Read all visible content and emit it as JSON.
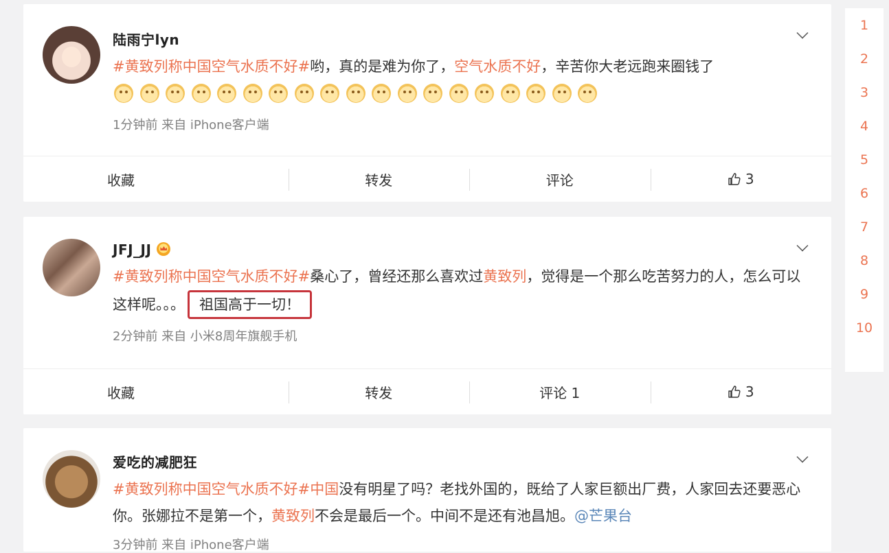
{
  "posts": [
    {
      "username": "陆雨宁lyn",
      "segments": [
        {
          "text": "#黄致列称中国空气水质不好#",
          "type": "hashtag"
        },
        {
          "text": "哟，真的是难为你了，",
          "type": "text"
        },
        {
          "text": "空气水质不好",
          "type": "highlight"
        },
        {
          "text": "，辛苦你大老远跑来圈钱了",
          "type": "text"
        }
      ],
      "emoji_name": "doge-emoji",
      "emoji_count": 19,
      "meta": "1分钟前 来自 iPhone客户端",
      "actions": {
        "favorite": "收藏",
        "repost": "转发",
        "comment": "评论",
        "like_count": "3"
      }
    },
    {
      "username": "JFJ_JJ",
      "segments": [
        {
          "text": "#黄致列称中国空气水质不好#",
          "type": "hashtag"
        },
        {
          "text": "桑心了，曾经还那么喜欢过",
          "type": "text"
        },
        {
          "text": "黄致列",
          "type": "highlight"
        },
        {
          "text": "，觉得是一个那么吃苦努力的人，怎么可以这样呢。。。",
          "type": "text"
        },
        {
          "text": "祖国高于一切！",
          "type": "boxed"
        }
      ],
      "meta": "2分钟前 来自 小米8周年旗舰手机",
      "actions": {
        "favorite": "收藏",
        "repost": "转发",
        "comment": "评论 1",
        "like_count": "3"
      }
    },
    {
      "username": "爱吃的减肥狂",
      "segments": [
        {
          "text": "#黄致列称中国空气水质不好#",
          "type": "hashtag"
        },
        {
          "text": "中国",
          "type": "highlight"
        },
        {
          "text": "没有明星了吗？老找外国的，既给了人家巨额出厂费，人家回去还要恶心你。张娜拉不是第一个，",
          "type": "text"
        },
        {
          "text": "黄致列",
          "type": "highlight"
        },
        {
          "text": "不会是最后一个。中间不是还有池昌旭。",
          "type": "text"
        },
        {
          "text": "@芒果台",
          "type": "mention"
        }
      ],
      "meta": "3分钟前 来自 iPhone客户端"
    }
  ],
  "pagination": [
    "1",
    "2",
    "3",
    "4",
    "5",
    "6",
    "7",
    "8",
    "9",
    "10"
  ],
  "colors": {
    "hashtag": "#eb7350",
    "mention": "#5b87b8",
    "box_border": "#c6343b",
    "background": "#f2f2f3"
  },
  "icons": [
    "chevron-down-icon",
    "thumbs-up-icon",
    "vip-crown-icon",
    "doge-emoji"
  ]
}
